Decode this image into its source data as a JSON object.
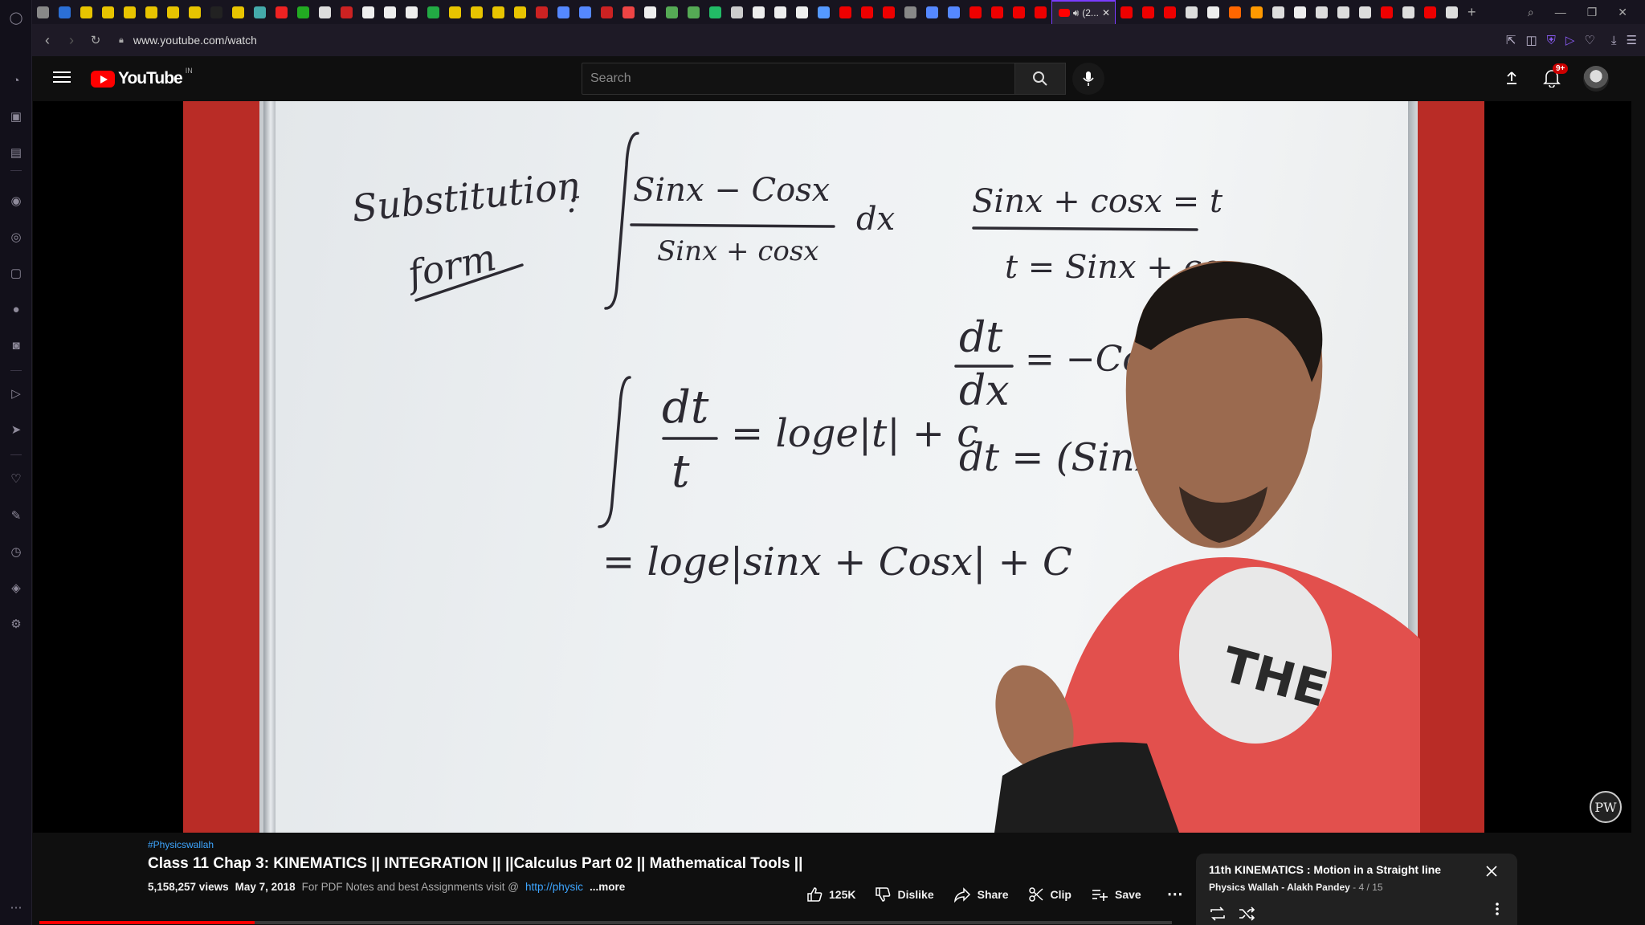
{
  "browser": {
    "active_tab_label": "(2...",
    "url": "www.youtube.com/watch",
    "tab_favicons": [
      "#888",
      "#2b6fd6",
      "#e8c400",
      "#e8c400",
      "#e8c400",
      "#e8c400",
      "#e8c400",
      "#e8c400",
      "#222",
      "#e8c400",
      "#4aa",
      "#e22",
      "#2a2",
      "#ddd",
      "#c22",
      "#eee",
      "#eee",
      "#eee",
      "#2a4",
      "#e8c400",
      "#e8c400",
      "#e8c400",
      "#e8c400",
      "#c22",
      "#58f",
      "#58f",
      "#c22",
      "#e44",
      "#eee",
      "#5a5",
      "#5a5",
      "#2b6",
      "#ccc",
      "#eee",
      "#eee",
      "#eee",
      "#59f",
      "#e00",
      "#e00",
      "#e00",
      "#888",
      "#58f",
      "#58f",
      "#e00",
      "#e00",
      "#e00",
      "#e00"
    ],
    "tab_favicons_after": [
      "#e00",
      "#e00",
      "#e00",
      "#ddd",
      "#eee",
      "#f60",
      "#f90",
      "#ddd",
      "#eee",
      "#ddd",
      "#ddd",
      "#ddd",
      "#e00",
      "#ddd",
      "#e00",
      "#ddd"
    ]
  },
  "youtube": {
    "logo_text": "YouTube",
    "region": "IN",
    "search_placeholder": "Search",
    "notification_count": "9+"
  },
  "video": {
    "hashtag": "#Physicswallah",
    "title": "Class 11 Chap 3: KINEMATICS || INTEGRATION || ||Calculus Part 02 || Mathematical Tools ||",
    "views": "5,158,257 views",
    "date": "May 7, 2018",
    "description": "For PDF Notes and best Assignments visit @",
    "description_link": "http://physic",
    "more": "...more",
    "progress_fraction": 0.19,
    "watermark": "PW",
    "board": {
      "line1_a": "Substitution",
      "line1_b": "form",
      "colon": ":",
      "int1_num": "Sinx − Cosx",
      "int1_den": "Sinx + cosx",
      "dx": "dx",
      "sub1": "Sinx + cosx = t",
      "sub2": "t = Sinx + co",
      "int2_num": "dt",
      "int2_den": "t",
      "int2_rhs": "= loge|t| + c",
      "deriv_num": "dt",
      "deriv_den": "dx",
      "deriv_rhs": "= −Cos",
      "dt_line": "dt = (Sinx − c",
      "result": "= loge|sinx + Cosx| + C"
    }
  },
  "actions": {
    "like_count": "125K",
    "dislike": "Dislike",
    "share": "Share",
    "clip": "Clip",
    "save": "Save"
  },
  "playlist": {
    "title": "11th KINEMATICS : Motion in a Straight line",
    "owner": "Physics Wallah - Alakh Pandey",
    "position": "4 / 15"
  }
}
